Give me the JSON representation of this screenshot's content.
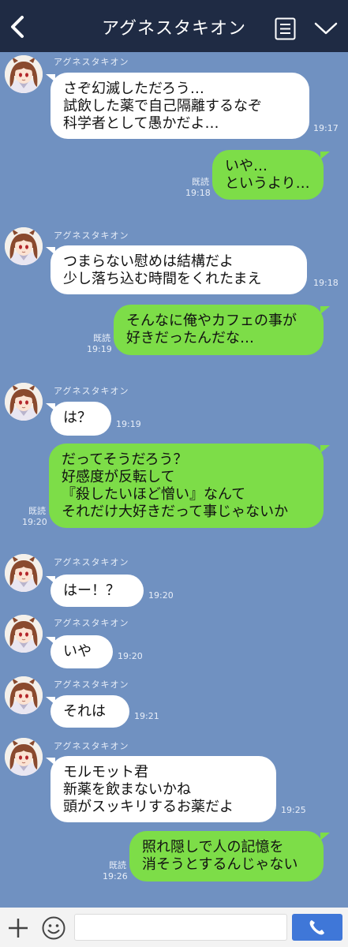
{
  "header": {
    "title": "アグネスタキオン",
    "back_icon": "chevron-left-icon",
    "menu_icon": "notes-icon",
    "more_icon": "chevron-down-icon"
  },
  "colors": {
    "header_bg": "#1f2b44",
    "chat_bg": "#7091c1",
    "incoming_bubble": "#ffffff",
    "outgoing_bubble": "#7ddd48",
    "send_button": "#3f77d8"
  },
  "messages": [
    {
      "dir": "in",
      "sender": "アグネスタキオン",
      "lines": [
        "さぞ幻滅しただろう…",
        "試飲した薬で自己隔離するなぞ",
        "科学者として愚かだよ…"
      ],
      "time": "19:17"
    },
    {
      "dir": "out",
      "lines": [
        "いや…",
        "というより…"
      ],
      "read": "既読",
      "time": "19:18"
    },
    {
      "dir": "in",
      "sender": "アグネスタキオン",
      "lines": [
        "つまらない慰めは結構だよ",
        "少し落ち込む時間をくれたまえ"
      ],
      "time": "19:18"
    },
    {
      "dir": "out",
      "lines": [
        "そんなに俺やカフェの事が",
        "好きだったんだな…"
      ],
      "read": "既読",
      "time": "19:19"
    },
    {
      "dir": "in",
      "sender": "アグネスタキオン",
      "lines": [
        "は？"
      ],
      "time": "19:19"
    },
    {
      "dir": "out",
      "lines": [
        "だってそうだろう？",
        "好感度が反転して",
        "『殺したいほど憎い』なんて",
        "それだけ大好きだって事じゃないか"
      ],
      "read": "既読",
      "time": "19:20"
    },
    {
      "dir": "in",
      "sender": "アグネスタキオン",
      "lines": [
        "はー！？"
      ],
      "time": "19:20"
    },
    {
      "dir": "in",
      "sender": "アグネスタキオン",
      "lines": [
        "いや"
      ],
      "time": "19:20"
    },
    {
      "dir": "in",
      "sender": "アグネスタキオン",
      "lines": [
        "それは"
      ],
      "time": "19:21"
    },
    {
      "dir": "in",
      "sender": "アグネスタキオン",
      "lines": [
        "モルモット君",
        "新薬を飲まないかね",
        "頭がスッキリするお薬だよ"
      ],
      "time": "19:25"
    },
    {
      "dir": "out",
      "lines": [
        "照れ隠しで人の記憶を",
        "消そうとするんじゃない"
      ],
      "read": "既読",
      "time": "19:26"
    }
  ],
  "inputbar": {
    "plus_icon": "plus-icon",
    "emoji_icon": "emoji-icon",
    "message_value": "",
    "call_icon": "phone-icon"
  }
}
